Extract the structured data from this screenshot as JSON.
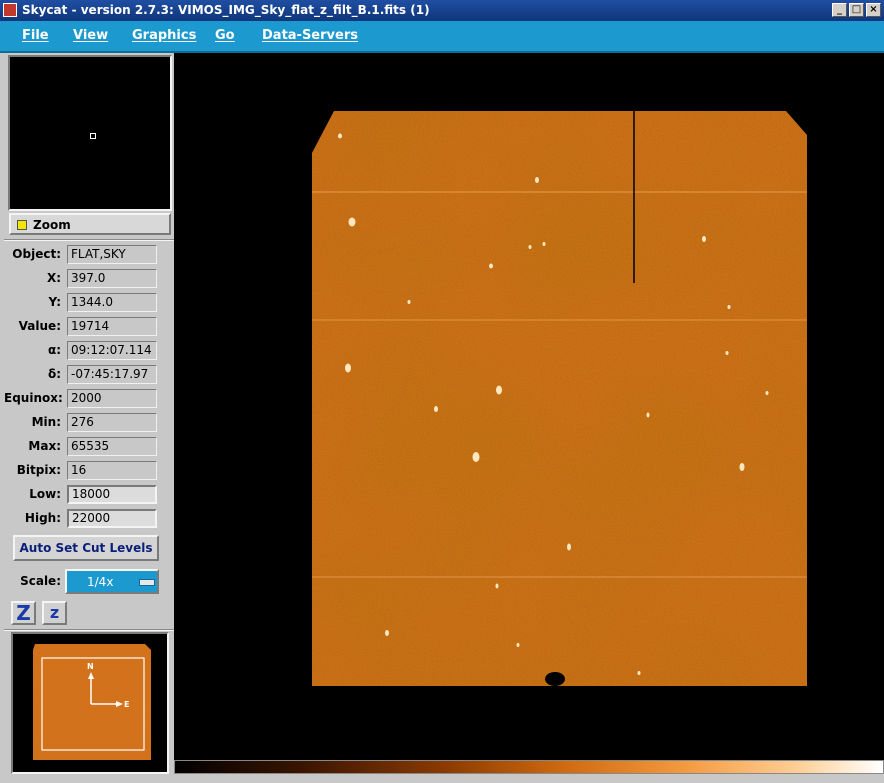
{
  "window": {
    "title": "Skycat - version 2.7.3: VIMOS_IMG_Sky_flat_z_filt_B.1.fits (1)",
    "icons": [
      "app-icon",
      "minimize-icon",
      "maximize-icon",
      "close-icon"
    ]
  },
  "menu": {
    "items": [
      "File",
      "View",
      "Graphics",
      "Go",
      "Data-Servers"
    ]
  },
  "zoom": {
    "label": "Zoom",
    "indicator_color": "#f2e600"
  },
  "fields": [
    {
      "label": "Object:",
      "value": "FLAT,SKY"
    },
    {
      "label": "X:",
      "value": "397.0"
    },
    {
      "label": "Y:",
      "value": "1344.0"
    },
    {
      "label": "Value:",
      "value": "19714"
    },
    {
      "label": "α:",
      "value": "09:12:07.114"
    },
    {
      "label": "δ:",
      "value": "-07:45:17.97"
    },
    {
      "label": "Equinox:",
      "value": "2000"
    },
    {
      "label": "Min:",
      "value": "276"
    },
    {
      "label": "Max:",
      "value": "65535"
    },
    {
      "label": "Bitpix:",
      "value": "16"
    },
    {
      "label": "Low:",
      "value": "18000"
    },
    {
      "label": "High:",
      "value": "22000"
    }
  ],
  "controls": {
    "auto_cut_label": "Auto Set Cut Levels",
    "scale_label": "Scale:",
    "scale_value": "1/4x",
    "zoom_in_label": "Z",
    "zoom_out_label": "z"
  },
  "panner": {
    "compass_north": "N",
    "compass_east": "E"
  },
  "colors": {
    "menu_bg": "#1c9ad0",
    "image_orange": "#d9731f",
    "panel_bg": "#c8c8c8"
  }
}
